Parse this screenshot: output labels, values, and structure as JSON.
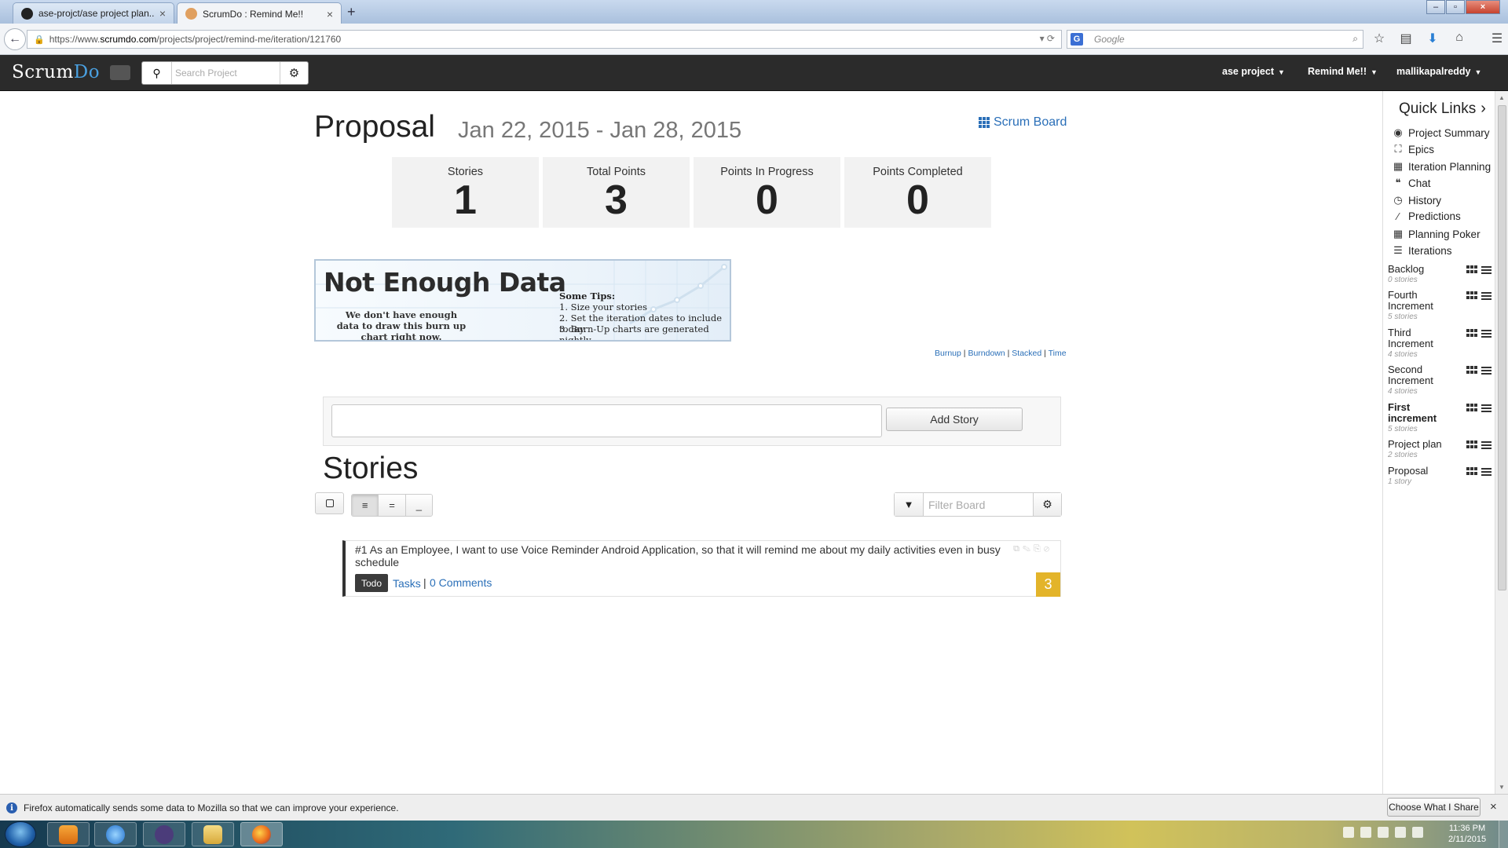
{
  "browser": {
    "tabs": [
      {
        "title": "ase-projct/ase project plan...",
        "active": false
      },
      {
        "title": "ScrumDo : Remind Me!!",
        "active": true
      }
    ],
    "url_prefix": "https://www.",
    "url_host": "scrumdo.com",
    "url_path": "/projects/project/remind-me/iteration/121760",
    "search_engine": "G",
    "search_placeholder": "Google"
  },
  "header": {
    "logo_main": "Scrum",
    "logo_accent": "Do",
    "search_placeholder": "Search Project",
    "menus": [
      "ase project",
      "Remind Me!!",
      "mallikapalreddy"
    ]
  },
  "iteration": {
    "title": "Proposal",
    "dates": "Jan 22, 2015 - Jan 28, 2015",
    "scrum_board_label": "Scrum Board"
  },
  "stats": [
    {
      "label": "Stories",
      "value": "1"
    },
    {
      "label": "Total Points",
      "value": "3"
    },
    {
      "label": "Points In Progress",
      "value": "0"
    },
    {
      "label": "Points Completed",
      "value": "0"
    }
  ],
  "chart_placeholder": {
    "title": "Not Enough Data",
    "subtitle": "We don't have enough data to draw this burn up chart right now.",
    "tips_heading": "Some Tips:",
    "tips": [
      "1. Size your stories",
      "2. Set the iteration dates to include today",
      "3. Burn-Up charts are generated nightly"
    ]
  },
  "chart_links": {
    "burnup": "Burnup",
    "burndown": "Burndown",
    "stacked": "Stacked",
    "time": "Time",
    "separator": "|"
  },
  "add_story": {
    "button": "Add Story"
  },
  "stories": {
    "title": "Stories",
    "filter_placeholder": "Filter Board",
    "view_modes": [
      "list",
      "compact",
      "minimal"
    ],
    "view_glyphs": [
      "≡",
      "=",
      "_"
    ],
    "items": [
      {
        "text": "#1 As an Employee, I want to use Voice Reminder Android Application, so that it will remind me about my daily activities even in busy schedule",
        "status": "Todo",
        "tasks_label": "Tasks",
        "comments_label": "0 Comments",
        "points": "3",
        "points_color": "#e3b42a"
      }
    ]
  },
  "quick_links": {
    "title": "Quick Links",
    "links": [
      {
        "label": "Project Summary",
        "icon": "globe-icon",
        "glyph": "◉"
      },
      {
        "label": "Epics",
        "icon": "sitemap-icon",
        "glyph": "⛶"
      },
      {
        "label": "Iteration Planning",
        "icon": "calendar-icon",
        "glyph": "▦"
      },
      {
        "label": "Chat",
        "icon": "quote-icon",
        "glyph": "❝"
      },
      {
        "label": "History",
        "icon": "clock-icon",
        "glyph": "◷"
      },
      {
        "label": "Predictions",
        "icon": "magic-wand-icon",
        "glyph": "⁄"
      },
      {
        "label": "Planning Poker",
        "icon": "grid-icon",
        "glyph": "▦"
      },
      {
        "label": "Iterations",
        "icon": "list-icon",
        "glyph": "☰"
      }
    ],
    "iterations": [
      {
        "name": "Backlog",
        "count": "0 stories",
        "bold": false
      },
      {
        "name": "Fourth Increment",
        "count": "5 stories",
        "bold": false
      },
      {
        "name": "Third Increment",
        "count": "4 stories",
        "bold": false
      },
      {
        "name": "Second Increment",
        "count": "4 stories",
        "bold": false
      },
      {
        "name": "First increment",
        "count": "5 stories",
        "bold": true
      },
      {
        "name": "Project plan",
        "count": "2 stories",
        "bold": false
      },
      {
        "name": "Proposal",
        "count": "1 story",
        "bold": false
      }
    ]
  },
  "notification": {
    "text": "Firefox automatically sends some data to Mozilla so that we can improve your experience.",
    "button": "Choose What I Share"
  },
  "taskbar": {
    "time": "11:36 PM",
    "date": "2/11/2015"
  }
}
